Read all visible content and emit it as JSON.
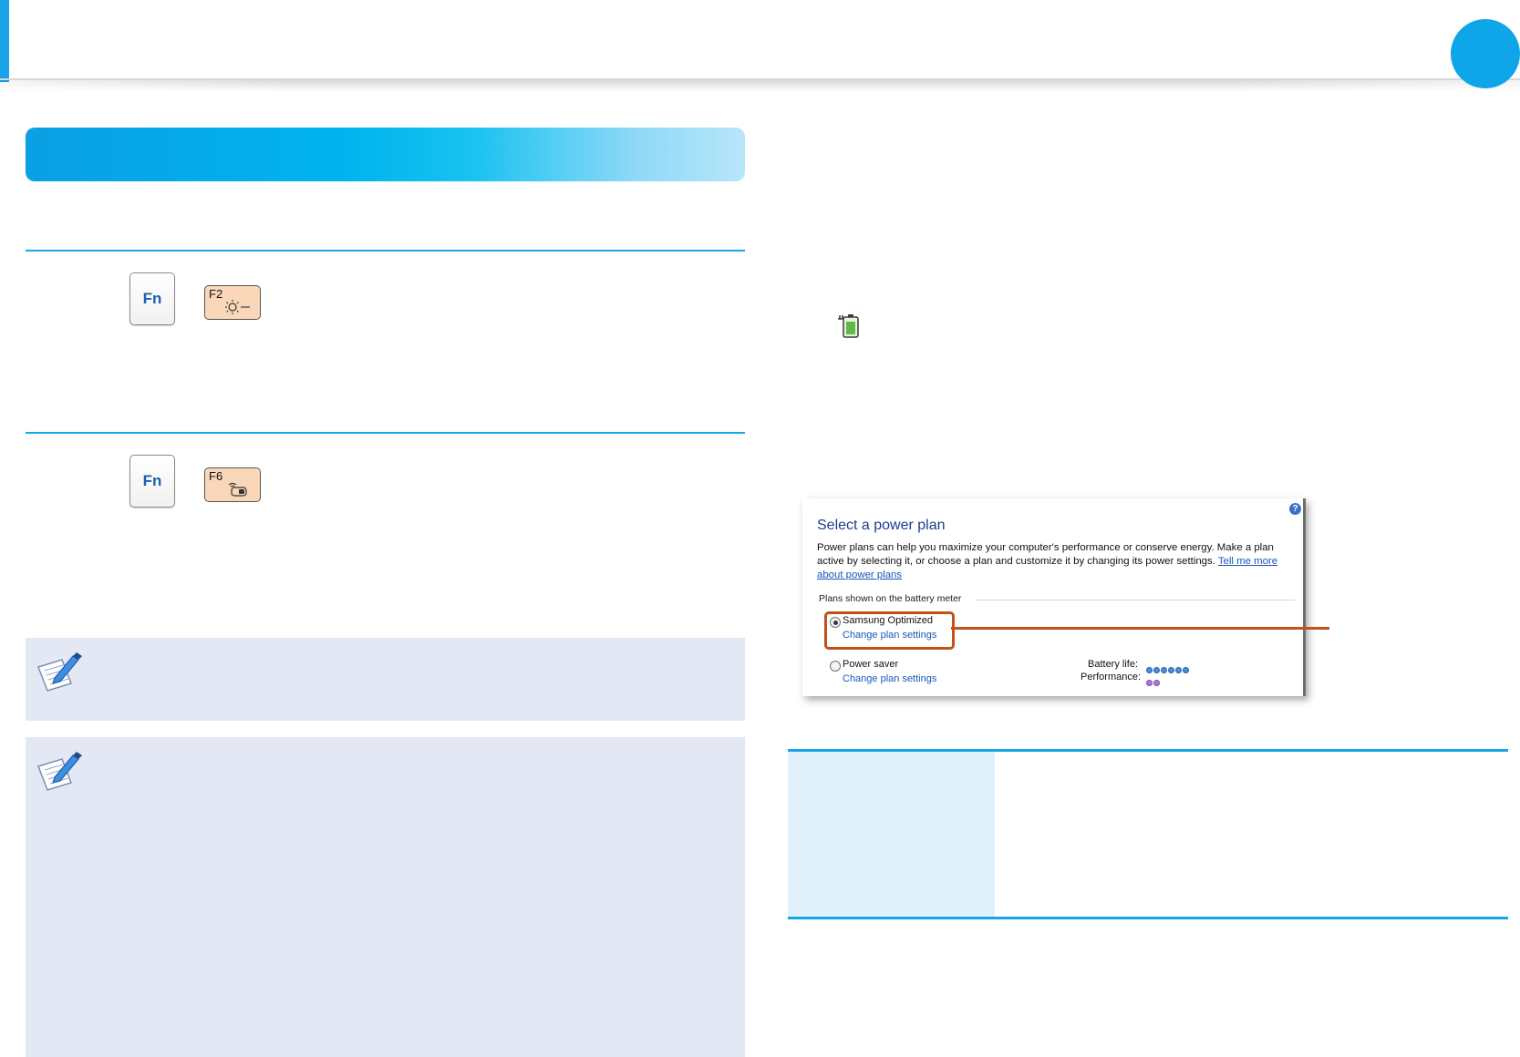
{
  "header": {
    "page_indicator": ""
  },
  "keys": {
    "fn_label": "Fn",
    "brightness_key": "F2",
    "wifi_key": "F6"
  },
  "power_plan": {
    "title": "Select a power plan",
    "description": "Power plans can help you maximize your computer's performance or conserve energy. Make a plan active by selecting it, or choose a plan and customize it by changing its power settings.",
    "tell_me_more_link": "Tell me more about power plans",
    "group_label": "Plans shown on the battery meter",
    "plans": [
      {
        "name": "Samsung Optimized",
        "link": "Change plan settings",
        "selected": true
      },
      {
        "name": "Power saver",
        "link": "Change plan settings",
        "selected": false
      }
    ],
    "battery_life_label": "Battery life:",
    "battery_life_rating": 6,
    "performance_label": "Performance:",
    "performance_rating": 2,
    "help_icon": "question-mark-icon"
  },
  "colors": {
    "accent_blue": "#16a6e6",
    "banner_start": "#0aa0e4",
    "banner_end": "#b8e6fa",
    "note_background": "#e4e8f4",
    "highlight_orange": "#c4511a",
    "keycap_orange": "#f9d7b8",
    "table_cell_bg": "#e0f1fc"
  },
  "icons": {
    "brightness_down": "sun-minus-icon",
    "wireless": "wireless-toggle-icon",
    "battery": "battery-plug-icon",
    "note": "note-pencil-icon"
  }
}
